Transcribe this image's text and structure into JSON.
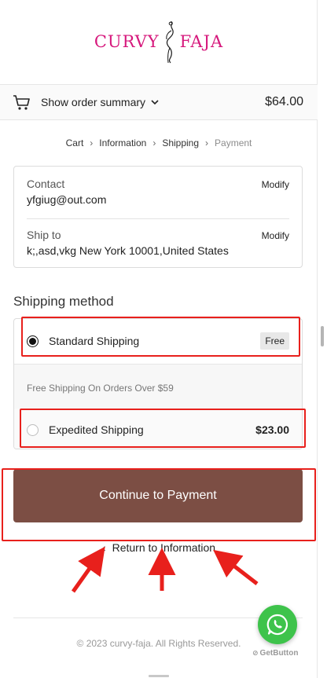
{
  "brand": {
    "left": "CURVY",
    "right": "FAJA",
    "color": "#d6187c"
  },
  "summary": {
    "label": "Show order summary",
    "total": "$64.00"
  },
  "breadcrumb": [
    {
      "label": "Cart"
    },
    {
      "label": "Information"
    },
    {
      "label": "Shipping"
    },
    {
      "label": "Payment"
    }
  ],
  "contact": {
    "label": "Contact",
    "value": "yfgiug@out.com",
    "modify": "Modify"
  },
  "ship_to": {
    "label": "Ship to",
    "value": "k;,asd,vkg New York 10001,United States",
    "modify": "Modify"
  },
  "shipping": {
    "title": "Shipping method",
    "options": [
      {
        "name": "Standard Shipping",
        "price": "Free",
        "selected": true
      },
      {
        "name": "Expedited Shipping",
        "price": "$23.00",
        "selected": false
      }
    ],
    "promo": "Free Shipping On Orders Over $59"
  },
  "continue_label": "Continue to Payment",
  "return_label": "Return to Information",
  "footer": "© 2023 curvy-faja. All Rights Reserved.",
  "getbutton": "GetButton",
  "colors": {
    "button": "#7c4e44",
    "highlight": "#e8201c",
    "whatsapp": "#3ec34b"
  }
}
